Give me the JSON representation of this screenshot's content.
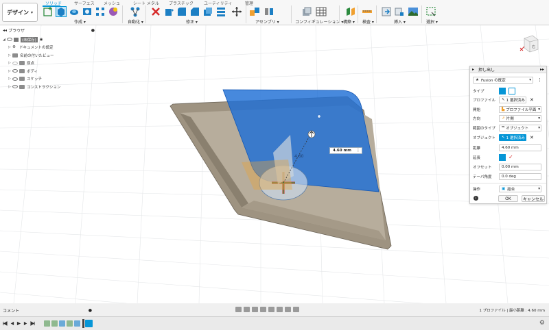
{
  "toolbar": {
    "workspace_label": "デザイン",
    "tabs": [
      "ソリッド",
      "サーフェス",
      "メッシュ",
      "シート メタル",
      "プラスチック",
      "ユーティリティ",
      "管理"
    ],
    "groups": [
      "作成",
      "自動化",
      "修正",
      "アセンブリ",
      "コンフィギュレーション",
      "構築",
      "検査",
      "挿入",
      "選択"
    ]
  },
  "browser": {
    "title": "ブラウザ",
    "root": "(未保存)",
    "items": [
      "ドキュメントの設定",
      "名前の付いたビュー",
      "原点",
      "ボディ",
      "スケッチ",
      "コンストラクション"
    ]
  },
  "viewcube": {
    "label": "右"
  },
  "model": {
    "dimension_value": "4.60 mm",
    "dimension_short": "4.60"
  },
  "dialog": {
    "title": "押し出し",
    "preset": "Fusion の既定",
    "rows": {
      "type_label": "タイプ",
      "profile_label": "プロファイル",
      "profile_value": "1 選択済み",
      "start_label": "開始",
      "start_value": "プロファイル平面",
      "direction_label": "方向",
      "direction_value": "片側",
      "extent_label": "範囲のタイプ",
      "extent_value": "オブジェクト",
      "object_label": "オブジェクト",
      "object_value": "1 選択済み",
      "distance_label": "距離",
      "distance_value": "4.60 mm",
      "extend_label": "延長",
      "offset_label": "オフセット",
      "offset_value": "0.00 mm",
      "taper_label": "テーパ角度",
      "taper_value": "0.0 deg",
      "operation_label": "操作",
      "operation_value": "結合"
    },
    "ok_label": "OK",
    "cancel_label": "キャンセル"
  },
  "comment_label": "コメント",
  "status_text": "1 プロファイル | 最小距離 : 4.60 mm",
  "colors": {
    "accent": "#0696d7",
    "body": "#9e9381",
    "selection": "#1e6fd6"
  }
}
